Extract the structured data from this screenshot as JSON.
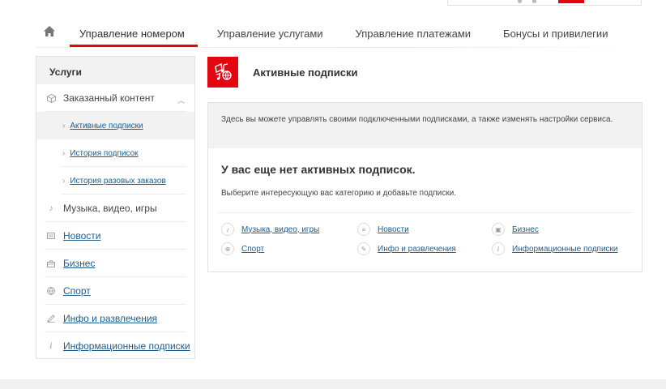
{
  "nav": {
    "tabs": [
      {
        "label": "Управление номером",
        "active": true
      },
      {
        "label": "Управление услугами"
      },
      {
        "label": "Управление платежами"
      },
      {
        "label": "Бонусы и привилегии"
      }
    ]
  },
  "sidebar": {
    "header": "Услуги",
    "group": {
      "label": "Заказанный контент",
      "sub_items": [
        {
          "label": "Активные подписки",
          "active": true
        },
        {
          "label": "История подписок"
        },
        {
          "label": "История разовых заказов"
        }
      ]
    },
    "items": [
      {
        "label": "Музыка, видео, игры",
        "icon": "music-icon",
        "link": false
      },
      {
        "label": "Новости",
        "icon": "news-icon",
        "link": true
      },
      {
        "label": "Бизнес",
        "icon": "briefcase-icon",
        "link": true
      },
      {
        "label": "Спорт",
        "icon": "ball-icon",
        "link": true
      },
      {
        "label": "Инфо и развлечения",
        "icon": "pencil-icon",
        "link": true
      },
      {
        "label": "Информационные подписки",
        "icon": "info-icon",
        "link": true
      }
    ]
  },
  "content": {
    "title": "Активные подписки",
    "info_text": "Здесь вы можете управлять своими подключенными подписками, а также изменять настройки сервиса.",
    "empty_heading": "У вас еще нет активных подписок.",
    "empty_hint": "Выберите интересующую вас категорию и добавьте подписки.",
    "categories": [
      {
        "label": "Музыка, видео, игры",
        "icon": "music-icon"
      },
      {
        "label": "Новости",
        "icon": "news-icon"
      },
      {
        "label": "Бизнес",
        "icon": "briefcase-icon"
      },
      {
        "label": "Спорт",
        "icon": "ball-icon"
      },
      {
        "label": "Инфо и развлечения",
        "icon": "pencil-icon"
      },
      {
        "label": "Информационные подписки",
        "icon": "info-icon"
      }
    ]
  },
  "colors": {
    "accent": "#e30611",
    "link": "#1c5d8f",
    "panel_bg": "#f2f2f2"
  }
}
